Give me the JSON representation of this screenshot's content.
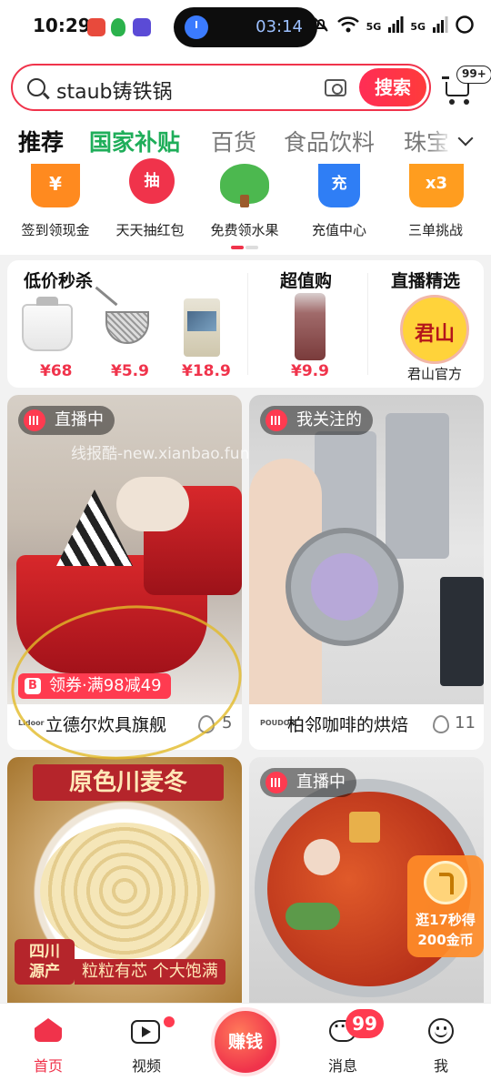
{
  "status": {
    "time": "10:29",
    "timer": "03:14",
    "network_a": "5G",
    "network_b": "5G"
  },
  "search": {
    "query": "staub铸铁锅",
    "button": "搜索"
  },
  "cart": {
    "badge": "99+"
  },
  "tabs": [
    "推荐",
    "国家补贴",
    "百货",
    "食品饮料",
    "珠宝"
  ],
  "quick_entries": [
    {
      "label": "签到领现金",
      "glyph": "¥",
      "color": "#ff8a1f"
    },
    {
      "label": "天天抽红包",
      "glyph": "抽",
      "color": "#f0334b"
    },
    {
      "label": "免费领水果",
      "glyph": "",
      "color": "#4cb84f"
    },
    {
      "label": "充值中心",
      "glyph": "充",
      "color": "#2f7ef5"
    },
    {
      "label": "三单挑战",
      "glyph": "x3",
      "color": "#ff9d1f"
    }
  ],
  "promo": {
    "flash": {
      "title": "低价秒杀",
      "prices": [
        "¥68",
        "¥5.9",
        "¥18.9"
      ]
    },
    "value": {
      "title": "超值购",
      "price": "¥9.9"
    },
    "live": {
      "title": "直播精选",
      "avatar_text": "君山",
      "name": "君山官方"
    }
  },
  "watermark": "线报酷-new.xianbao.fun",
  "feed": [
    {
      "tag": "直播中",
      "coupon_icon": "B",
      "coupon": "领券·满98减49",
      "shop_logo": "Lidoor",
      "shop": "立德尔炊具旗舰",
      "count": "5"
    },
    {
      "tag": "我关注的",
      "shop_logo": "POUDOR",
      "shop": "柏邻咖啡的烘焙",
      "count": "11"
    },
    {
      "banner": "原色川麦冬",
      "badge_line1": "四川",
      "badge_line2": "源产",
      "slogan": "粒粒有芯 个大饱满"
    },
    {
      "tag": "直播中",
      "reward_line1": "逛17秒得",
      "reward_line2": "200金币"
    }
  ],
  "nav": {
    "home": "首页",
    "video": "视频",
    "earn": "赚钱",
    "messages": "消息",
    "messages_badge": "99",
    "me": "我"
  }
}
